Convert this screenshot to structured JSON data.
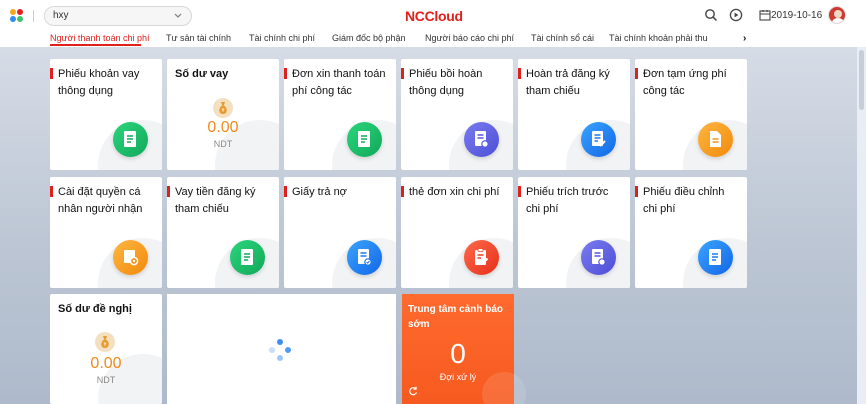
{
  "header": {
    "org_value": "hxy",
    "brand": "NCCloud",
    "date": "2019-10-16",
    "icons": [
      "app-grid-icon",
      "chevron-down-icon",
      "search-icon",
      "play-circle-icon",
      "calendar-icon",
      "user-avatar-icon"
    ]
  },
  "tabs": [
    {
      "label": "Người thanh toán chi phí",
      "active": true
    },
    {
      "label": "Tư sản tài chính"
    },
    {
      "label": "Tài chính chi phí"
    },
    {
      "label": "Giám đốc bộ phận"
    },
    {
      "label": "Người báo cáo chi phí"
    },
    {
      "label": "Tài chính sổ cái"
    },
    {
      "label": "Tài chính khoản phải thu"
    }
  ],
  "cards": [
    {
      "title": "Phiếu khoản vay thông dụng",
      "color": "green",
      "icon": "document-icon"
    },
    {
      "title": "Số dư vay",
      "value": "0.00",
      "currency": "NDT",
      "icon": "money-bag-icon"
    },
    {
      "title": "Đơn xin thanh toán phí công tác",
      "color": "green",
      "icon": "document-icon"
    },
    {
      "title": "Phiếu bồi hoàn thông dụng",
      "color": "purple",
      "icon": "document-settings-icon"
    },
    {
      "title": "Hoàn trả đăng ký tham chiếu",
      "color": "blue",
      "icon": "document-edit-icon"
    },
    {
      "title": "Đơn tạm ứng phí công tác",
      "color": "orange",
      "icon": "file-icon"
    },
    {
      "title": "Cài đặt quyền cá nhân người nhận",
      "color": "orange",
      "icon": "settings-icon"
    },
    {
      "title": "Vay tiền đăng ký tham chiếu",
      "color": "green",
      "icon": "document-icon"
    },
    {
      "title": "Giấy trả nợ",
      "color": "blue",
      "icon": "document-check-icon"
    },
    {
      "title": "thẻ đơn xin chi phí",
      "color": "red",
      "icon": "clipboard-edit-icon"
    },
    {
      "title": "Phiếu trích trước chi phí",
      "color": "purple",
      "icon": "document-settings-icon"
    },
    {
      "title": "Phiếu điều chỉnh chi phí",
      "color": "blue",
      "icon": "document-icon"
    },
    {
      "title": "Số dư đề nghị",
      "value": "0.00",
      "currency": "NDT",
      "icon": "money-bag-icon"
    }
  ],
  "warning": {
    "title": "Trung tâm cảnh báo sớm",
    "count": "0",
    "label": "Đợi xử lý",
    "icon": "refresh-icon"
  },
  "loading": {
    "icon": "loading-spinner-icon"
  },
  "colors": {
    "accent": "#e0201b",
    "green": "#1db86a",
    "purple": "#5f61e4",
    "blue": "#2384f5",
    "orange": "#f7a21e",
    "red": "#f2472a",
    "warning_bg": "#f65a1f",
    "balance": "#f08a1c"
  }
}
